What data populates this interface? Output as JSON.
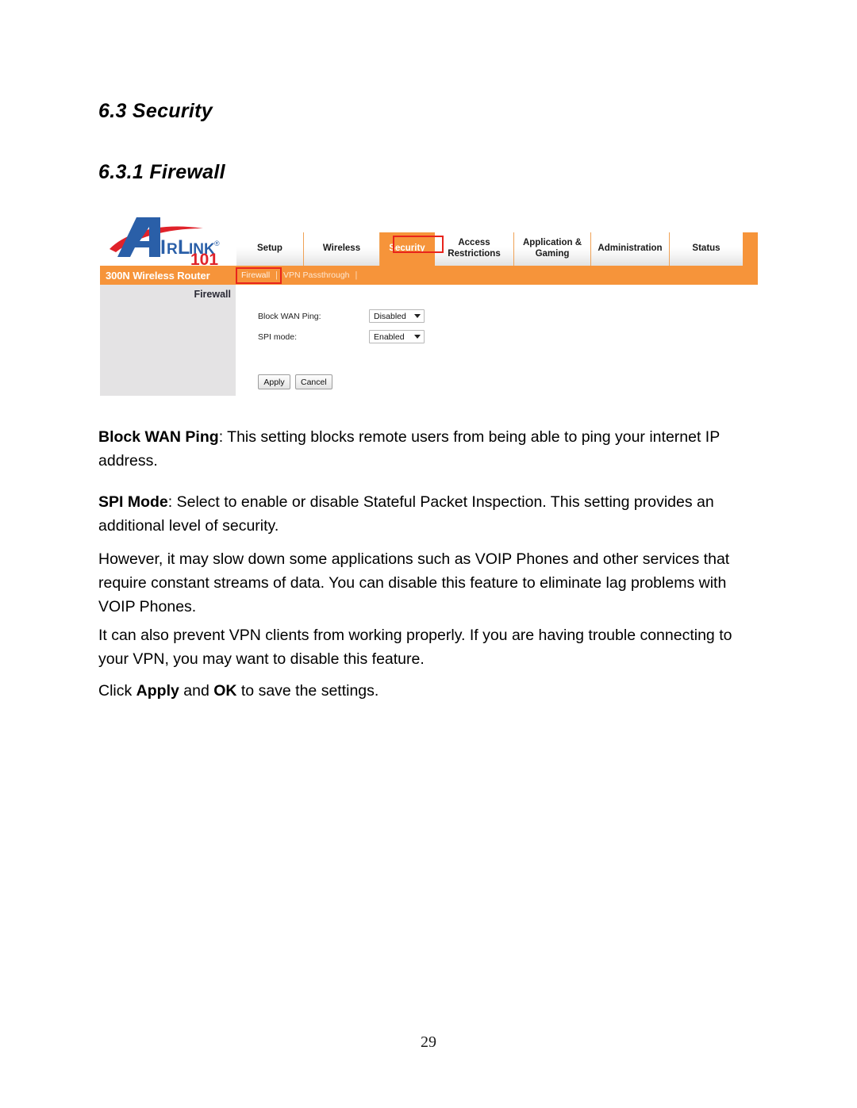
{
  "document": {
    "heading_section": "6.3 Security",
    "heading_subsection": "6.3.1 Firewall",
    "page_number": "29"
  },
  "router_ui": {
    "brand": {
      "name": "AIRLINK",
      "name_part_1": "A",
      "name_part_2": "IR",
      "name_part_3": "L",
      "name_part_4": "INK",
      "registered_mark": "®",
      "model_number": "101",
      "logo_blue": "#2a5fa8",
      "logo_red": "#e0222a"
    },
    "model_name": "300N Wireless Router",
    "accent_orange": "#f6943a",
    "annotation_red": "#e8241c",
    "tabs": [
      {
        "label": "Setup",
        "active": false
      },
      {
        "label": "Wireless",
        "active": false
      },
      {
        "label": "Security",
        "active": true
      },
      {
        "label": "Access\nRestrictions",
        "line1": "Access",
        "line2": "Restrictions",
        "active": false
      },
      {
        "label": "Application &\nGaming",
        "line1": "Application &",
        "line2": "Gaming",
        "active": false
      },
      {
        "label": "Administration",
        "active": false
      },
      {
        "label": "Status",
        "active": false
      }
    ],
    "subtabs": [
      {
        "label": "Firewall",
        "current": true
      },
      {
        "label": "VPN Passthrough",
        "current": false
      }
    ],
    "subtab_separator": "|",
    "sidebar": {
      "title": "Firewall"
    },
    "form": {
      "fields": [
        {
          "label": "Block WAN Ping:",
          "value": "Disabled"
        },
        {
          "label": "SPI mode:",
          "value": "Enabled"
        }
      ],
      "buttons": [
        {
          "label": "Apply"
        },
        {
          "label": "Cancel"
        }
      ]
    }
  },
  "body_text": {
    "p1_bold": "Block WAN Ping",
    "p1_rest": ":  This setting blocks remote users from being able to ping your internet IP address.",
    "p2_bold": "SPI Mode",
    "p2_rest": ": Select to enable or disable Stateful Packet Inspection.  This setting provides an additional level of security.",
    "p3": "However, it may slow down some applications such as VOIP Phones and other services that require constant streams of data.  You can disable this feature to eliminate lag problems with VOIP Phones.",
    "p4": "It can also prevent VPN clients from working properly.  If you are having trouble connecting to your VPN, you may want to disable this feature.",
    "p5_pre": "Click ",
    "p5_bold_1": "Apply",
    "p5_mid": " and ",
    "p5_bold_2": "OK",
    "p5_post": " to save the settings."
  }
}
